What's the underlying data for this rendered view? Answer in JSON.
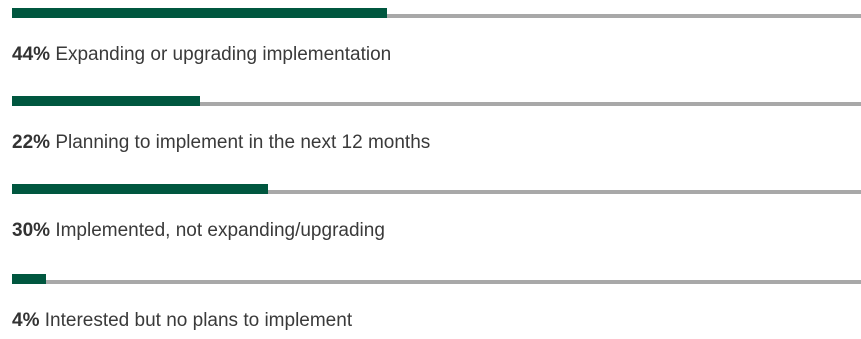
{
  "chart_data": {
    "type": "bar",
    "orientation": "horizontal",
    "categories": [
      "Expanding or upgrading implementation",
      "Planning to implement in the next 12 months",
      "Implemented, not expanding/upgrading",
      "Interested but no plans to implement"
    ],
    "values": [
      44,
      22,
      30,
      4
    ],
    "value_labels": [
      "44%",
      "22%",
      "30%",
      "4%"
    ],
    "unit": "%",
    "xlim": [
      0,
      100
    ],
    "grid": false,
    "colors": {
      "fill": "#00573f",
      "track": "#a8a8a8",
      "text": "#3a3a3a"
    }
  }
}
